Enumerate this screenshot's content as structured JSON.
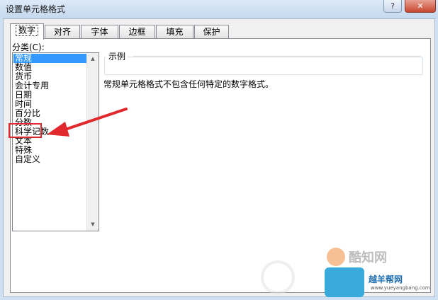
{
  "window": {
    "title": "设置单元格格式",
    "help_label": "?",
    "close_label": "✕"
  },
  "tabs": [
    {
      "label": "数字",
      "active": true
    },
    {
      "label": "对齐",
      "active": false
    },
    {
      "label": "字体",
      "active": false
    },
    {
      "label": "边框",
      "active": false
    },
    {
      "label": "填充",
      "active": false
    },
    {
      "label": "保护",
      "active": false
    }
  ],
  "category": {
    "label": "分类(C):",
    "items": [
      "常规",
      "数值",
      "货币",
      "会计专用",
      "日期",
      "时间",
      "百分比",
      "分数",
      "科学记数",
      "文本",
      "特殊",
      "自定义"
    ],
    "selected_index": 0,
    "highlighted_item": "文本"
  },
  "sample": {
    "label": "示例",
    "value": ""
  },
  "description": "常规单元格格式不包含任何特定的数字格式。",
  "scroll": {
    "up_icon": "triangle-up-icon",
    "down_icon": "triangle-down-icon"
  },
  "annotation": {
    "color": "#e0282d"
  },
  "watermarks": {
    "brand": "酷知网",
    "brand2": "越羊帮网",
    "url": "www.yueyangbang.com"
  },
  "colors": {
    "selection": "#3399ff",
    "titlebar": "#cfe0f2"
  }
}
